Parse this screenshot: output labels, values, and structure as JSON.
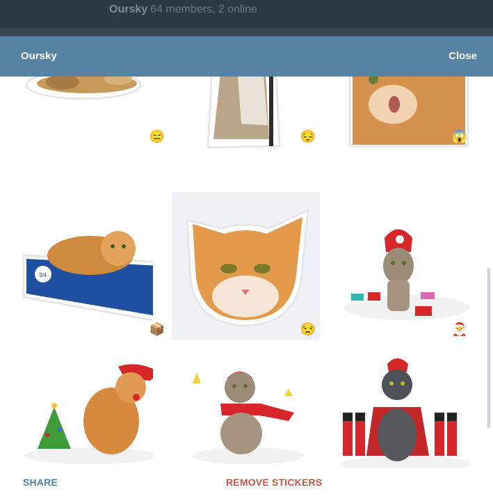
{
  "background_chat": {
    "title": "Oursky",
    "subtitle": "64 members, 2 online"
  },
  "modal": {
    "title": "Oursky",
    "close_label": "Close"
  },
  "stickers": [
    {
      "description_icon": "cat-lying-sticker",
      "emoji": "😑"
    },
    {
      "description_icon": "cat-leaning-sticker",
      "emoji": "😔"
    },
    {
      "description_icon": "cat-closeup-sticker",
      "emoji": "😱"
    },
    {
      "description_icon": "cat-in-box-sticker",
      "emoji": "📦"
    },
    {
      "description_icon": "cat-face-sticker",
      "emoji": "😒"
    },
    {
      "description_icon": "cat-santa-hat-socks-sticker",
      "emoji": "🎅"
    },
    {
      "description_icon": "cat-christmas-tree-sticker",
      "emoji": "🎅"
    },
    {
      "description_icon": "cat-red-scarf-sticker",
      "emoji": "🎅"
    },
    {
      "description_icon": "cat-toy-soldiers-sticker",
      "emoji": "🎅"
    }
  ],
  "footer": {
    "share_label": "SHARE",
    "remove_label": "REMOVE STICKERS"
  },
  "colors": {
    "header": "#5682a3",
    "share": "#4f7ea3",
    "remove": "#c2564a"
  }
}
